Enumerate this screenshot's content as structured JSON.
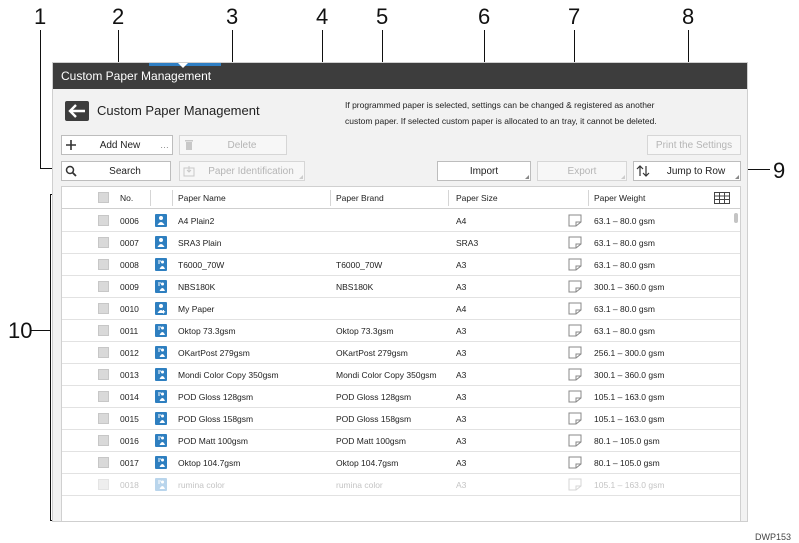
{
  "callouts": [
    "1",
    "2",
    "3",
    "4",
    "5",
    "6",
    "7",
    "8",
    "9",
    "10"
  ],
  "figure_code": "DWP153",
  "window": {
    "title": "Custom Paper Management"
  },
  "header": {
    "title": "Custom Paper Management",
    "notice_line1": "If programmed paper is selected, settings can be changed & registered as another",
    "notice_line2": "custom paper. If selected custom paper is allocated to an tray, it cannot be deleted."
  },
  "toolbar": {
    "add_new": "Add New",
    "delete": "Delete",
    "print_settings": "Print the Settings",
    "search": "Search",
    "paper_identification": "Paper Identification",
    "import": "Import",
    "export": "Export",
    "jump_to_row": "Jump to Row"
  },
  "table": {
    "columns": [
      "No.",
      "Paper Name",
      "Paper Brand",
      "Paper Size",
      "Paper Weight"
    ],
    "rows": [
      {
        "no": "0006",
        "name": "A4 Plain2",
        "brand": "",
        "size": "A4",
        "weight": "63.1 – 80.0 gsm",
        "icon": "user-paper-icon"
      },
      {
        "no": "0007",
        "name": "SRA3 Plain",
        "brand": "",
        "size": "SRA3",
        "weight": "63.1 – 80.0 gsm",
        "icon": "user-paper-icon"
      },
      {
        "no": "0008",
        "name": "T6000_70W",
        "brand": "T6000_70W",
        "size": "A3",
        "weight": "63.1 – 80.0 gsm",
        "icon": "catalog-paper-icon"
      },
      {
        "no": "0009",
        "name": "NBS180K",
        "brand": "NBS180K",
        "size": "A3",
        "weight": "300.1 – 360.0 gsm",
        "icon": "catalog-paper-icon"
      },
      {
        "no": "0010",
        "name": "My Paper",
        "brand": "",
        "size": "A4",
        "weight": "63.1 – 80.0 gsm",
        "icon": "user-paper-plus-icon"
      },
      {
        "no": "0011",
        "name": "Oktop 73.3gsm",
        "brand": "Oktop 73.3gsm",
        "size": "A3",
        "weight": "63.1 – 80.0 gsm",
        "icon": "catalog-paper-icon"
      },
      {
        "no": "0012",
        "name": "OKartPost 279gsm",
        "brand": "OKartPost 279gsm",
        "size": "A3",
        "weight": "256.1 – 300.0 gsm",
        "icon": "catalog-paper-icon"
      },
      {
        "no": "0013",
        "name": "Mondi Color Copy 350gsm",
        "brand": "Mondi Color Copy 350gsm",
        "size": "A3",
        "weight": "300.1 – 360.0 gsm",
        "icon": "catalog-paper-icon"
      },
      {
        "no": "0014",
        "name": "POD Gloss 128gsm",
        "brand": "POD Gloss 128gsm",
        "size": "A3",
        "weight": "105.1 – 163.0 gsm",
        "icon": "catalog-paper-icon"
      },
      {
        "no": "0015",
        "name": "POD Gloss 158gsm",
        "brand": "POD Gloss 158gsm",
        "size": "A3",
        "weight": "105.1 – 163.0 gsm",
        "icon": "catalog-paper-icon"
      },
      {
        "no": "0016",
        "name": "POD Matt 100gsm",
        "brand": "POD Matt 100gsm",
        "size": "A3",
        "weight": "80.1 – 105.0 gsm",
        "icon": "catalog-paper-icon"
      },
      {
        "no": "0017",
        "name": "Oktop 104.7gsm",
        "brand": "Oktop 104.7gsm",
        "size": "A3",
        "weight": "80.1 – 105.0 gsm",
        "icon": "catalog-paper-icon"
      },
      {
        "no": "0018",
        "name": "rumina color",
        "brand": "rumina color",
        "size": "A3",
        "weight": "105.1 – 163.0 gsm",
        "icon": "catalog-paper-icon"
      }
    ]
  },
  "colors": {
    "titlebar": "#3d3d3d",
    "accent": "#2f7fc4",
    "paper_icon": "#2e7fc0"
  }
}
